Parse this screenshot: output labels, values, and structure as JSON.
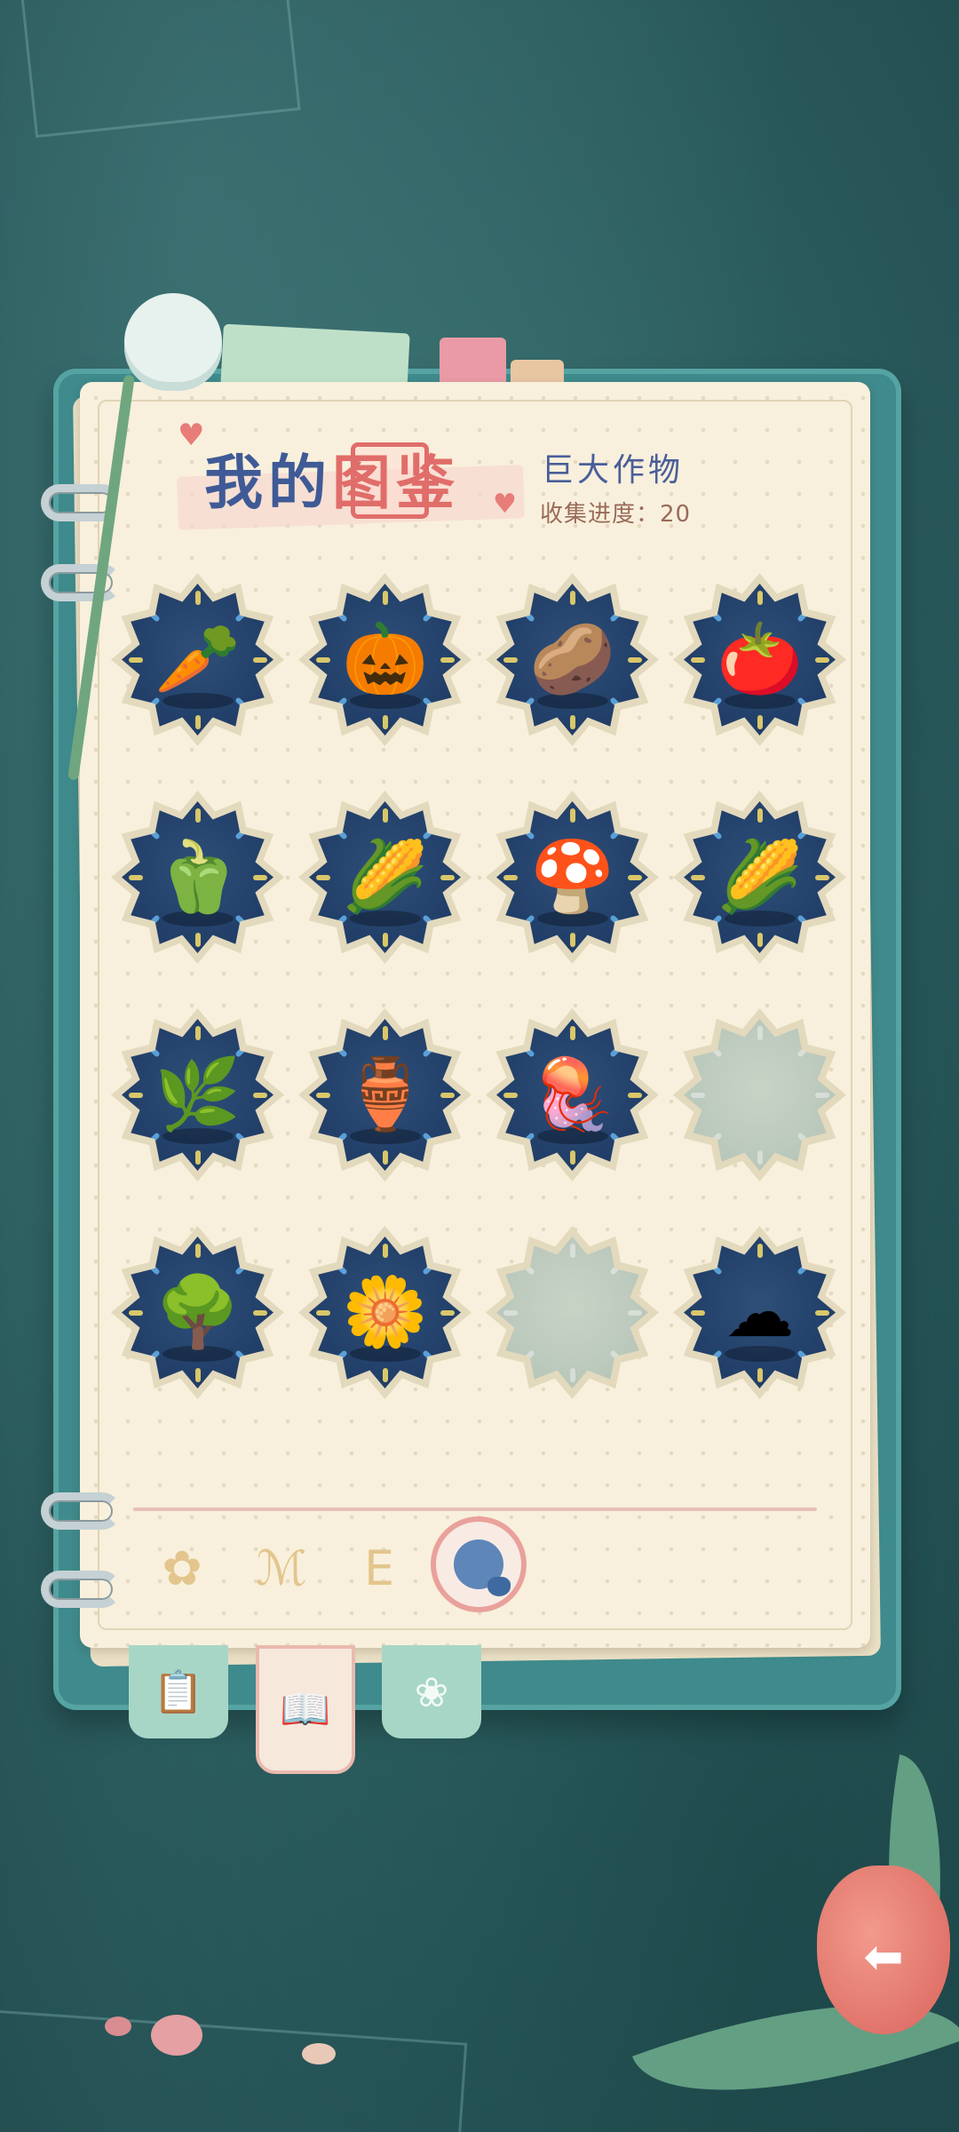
{
  "title": {
    "prefix": "我的",
    "boxed": "图",
    "suffix": "鉴"
  },
  "header": {
    "category": "巨大作物",
    "progress_label": "收集进度：",
    "progress_value": "20"
  },
  "grid": {
    "rows": 4,
    "cols": 4,
    "items": [
      {
        "icon": "carrot-icon",
        "glyph": "🥕",
        "unlocked": true
      },
      {
        "icon": "pumpkin-icon",
        "glyph": "🎃",
        "unlocked": true
      },
      {
        "icon": "potato-icon",
        "glyph": "🥔",
        "unlocked": true
      },
      {
        "icon": "tomato-icon",
        "glyph": "🍅",
        "unlocked": true
      },
      {
        "icon": "orange-pepper-icon",
        "glyph": "🫑",
        "unlocked": true
      },
      {
        "icon": "bamboo-shoot-icon",
        "glyph": "🌽",
        "unlocked": true
      },
      {
        "icon": "glowing-mushroom-icon",
        "glyph": "🍄",
        "unlocked": true
      },
      {
        "icon": "rainbow-corn-icon",
        "glyph": "🌽",
        "unlocked": true
      },
      {
        "icon": "twisted-tree-icon",
        "glyph": "🌿",
        "unlocked": true
      },
      {
        "icon": "purple-gourd-icon",
        "glyph": "🏺",
        "unlocked": true
      },
      {
        "icon": "jellyfish-plant-icon",
        "glyph": "🪼",
        "unlocked": true
      },
      {
        "icon": "locked-slot-icon",
        "glyph": "",
        "unlocked": false
      },
      {
        "icon": "golden-tree-icon",
        "glyph": "🌳",
        "unlocked": true
      },
      {
        "icon": "glowing-flower-icon",
        "glyph": "🌼",
        "unlocked": true
      },
      {
        "icon": "locked-slot-icon",
        "glyph": "",
        "unlocked": false
      },
      {
        "icon": "cloud-bud-icon",
        "glyph": "☁",
        "unlocked": true
      }
    ]
  },
  "category_tabs": [
    {
      "icon": "flower-category-icon",
      "glyph": "✿"
    },
    {
      "icon": "tree-category-icon",
      "glyph": "ℳ"
    },
    {
      "icon": "sprout-category-icon",
      "glyph": "ⴹ"
    },
    {
      "icon": "giant-crop-category-icon",
      "glyph": "",
      "active": true
    }
  ],
  "bottom_tabs": [
    {
      "icon": "notes-tab-icon",
      "glyph": "📋"
    },
    {
      "icon": "book-tab-icon",
      "glyph": "📖",
      "active": true
    },
    {
      "icon": "flower-tab-icon",
      "glyph": "❀"
    }
  ],
  "colors": {
    "background": "#2f6466",
    "page": "#f8f0dc",
    "badge": "#22406a",
    "accent_pink": "#e06d6a",
    "title_blue": "#3f5a96"
  }
}
